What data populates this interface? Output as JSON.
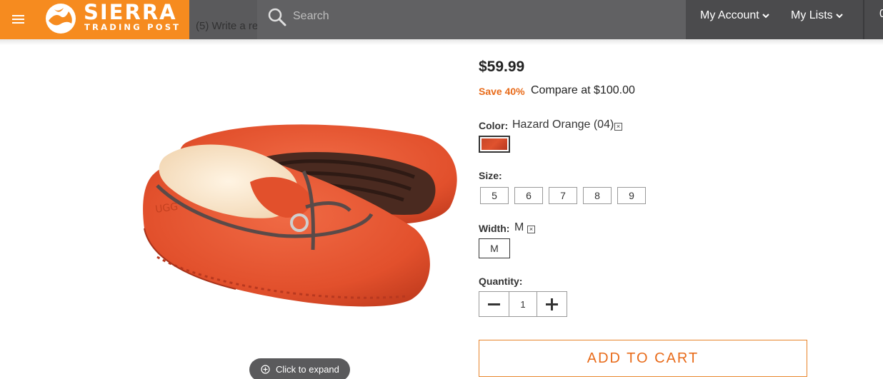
{
  "header": {
    "menu_icon": "hamburger-menu-icon",
    "logo": {
      "word": "SIERRA",
      "sub": "TRADING POST"
    },
    "review_link": "(5) Write a re",
    "search": {
      "placeholder": "Search",
      "icon": "search-icon"
    },
    "nav": [
      {
        "label": "My Account",
        "icon": "chevron-down-icon"
      },
      {
        "label": "My Lists",
        "icon": "chevron-down-icon"
      }
    ],
    "nav_cut": "0"
  },
  "product": {
    "expand_label": "Click to expand",
    "price": "$59.99",
    "save": "Save 40%",
    "compare": "Compare at $100.00",
    "color_label": "Color:",
    "color_value": "Hazard Orange (04)",
    "size_label": "Size:",
    "sizes": [
      "5",
      "6",
      "7",
      "8",
      "9"
    ],
    "width_label": "Width:",
    "width_value": "M",
    "width_options": [
      "M"
    ],
    "quantity_label": "Quantity:",
    "quantity": "1",
    "add_to_cart": "ADD TO CART"
  },
  "colors": {
    "brand_orange": "#f68b1f",
    "header_gray": "#4b4b4d",
    "save_orange": "#e86b1a"
  }
}
